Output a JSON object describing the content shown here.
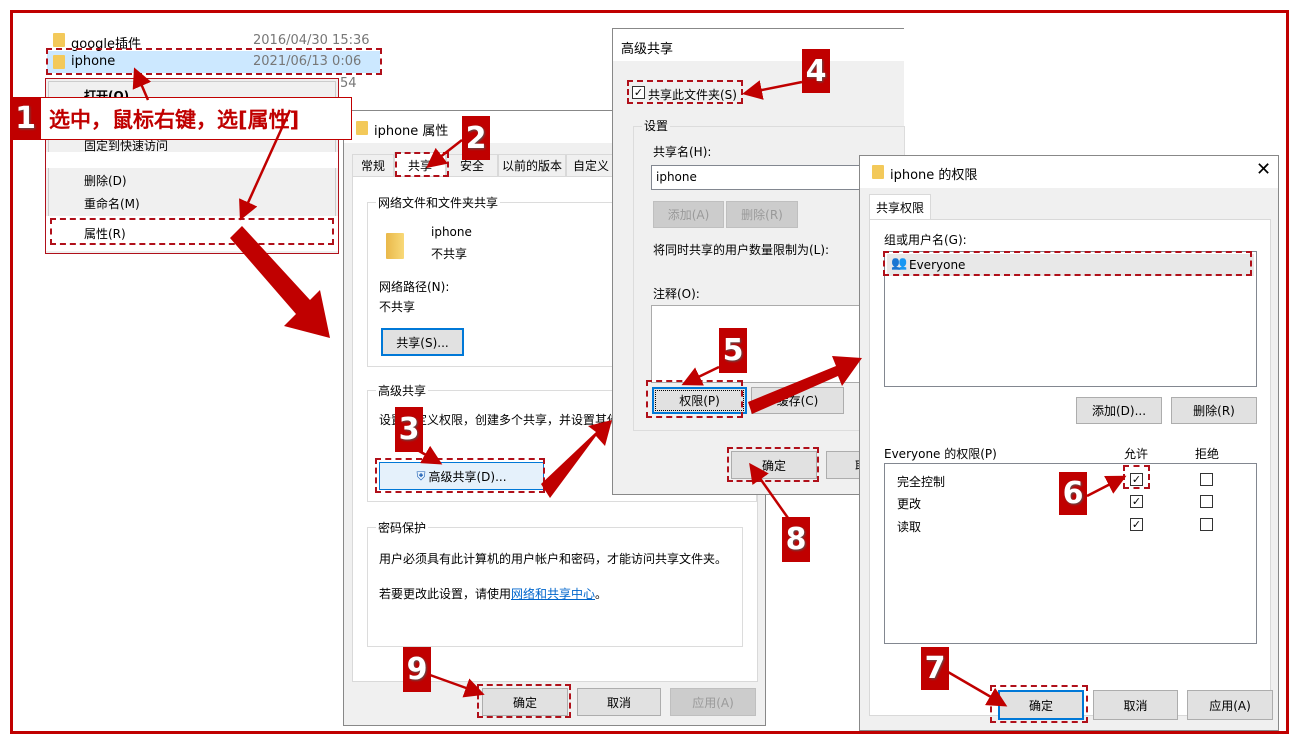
{
  "explorer": {
    "rows": [
      {
        "name": "google插件",
        "date": "2016/04/30 15:36"
      },
      {
        "name": "iphone",
        "date": "2021/06/13 0:06"
      }
    ],
    "partial_date": "54"
  },
  "context_menu": {
    "items": [
      "打开(O)",
      "固定到快速访问",
      "删除(D)",
      "重命名(M)",
      "属性(R)"
    ]
  },
  "callout": {
    "number": "1",
    "text": "选中，鼠标右键，选[属性]"
  },
  "properties": {
    "title": "iphone 属性",
    "tabs": [
      "常规",
      "共享",
      "安全",
      "以前的版本",
      "自定义"
    ],
    "net_group": "网络文件和文件夹共享",
    "folder_name": "iphone",
    "folder_status": "不共享",
    "path_label": "网络路径(N):",
    "path_value": "不共享",
    "share_button": "共享(S)...",
    "adv_group": "高级共享",
    "adv_desc": "设置自定义权限，创建多个共享，并设置其他",
    "adv_button": "高级共享(D)...",
    "pwd_group": "密码保护",
    "pwd_text": "用户必须具有此计算机的用户帐户和密码，才能访问共享文件夹。",
    "pwd_change": "若要更改此设置，请使用",
    "pwd_link": "网络和共享中心",
    "pwd_end": "。",
    "ok": "确定",
    "cancel": "取消",
    "apply": "应用(A)"
  },
  "advanced": {
    "title": "高级共享",
    "share_checkbox": "共享此文件夹(S)",
    "share_checked": true,
    "settings_group": "设置",
    "share_name_label": "共享名(H):",
    "share_name_value": "iphone",
    "add": "添加(A)",
    "remove": "删除(R)",
    "limit_label": "将同时共享的用户数量限制为(L):",
    "comment_label": "注释(O):",
    "permissions": "权限(P)",
    "cache": "缓存(C)",
    "ok": "确定",
    "cancel_partial": "取"
  },
  "perms": {
    "title": "iphone 的权限",
    "tab": "共享权限",
    "group_label": "组或用户名(G):",
    "users": [
      "Everyone"
    ],
    "add": "添加(D)...",
    "remove": "删除(R)",
    "perm_label": "Everyone 的权限(P)",
    "allow": "允许",
    "deny": "拒绝",
    "rows": [
      {
        "name": "完全控制",
        "allow": true,
        "deny": false
      },
      {
        "name": "更改",
        "allow": true,
        "deny": false
      },
      {
        "name": "读取",
        "allow": true,
        "deny": false
      }
    ],
    "ok": "确定",
    "cancel": "取消",
    "apply": "应用(A)"
  },
  "badges": [
    "2",
    "3",
    "4",
    "5",
    "6",
    "7",
    "8",
    "9"
  ],
  "colors": {
    "annotation": "#c00000",
    "selection": "#cce8ff",
    "accent": "#0078d7",
    "link": "#0066cc"
  }
}
